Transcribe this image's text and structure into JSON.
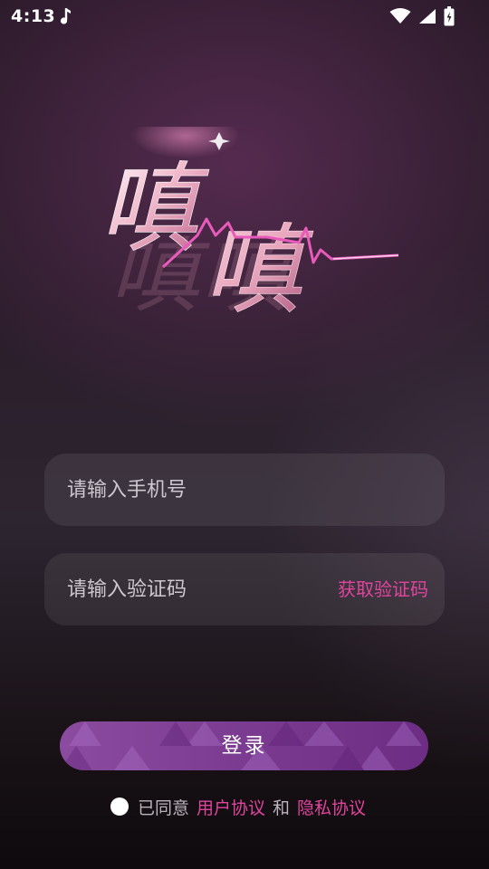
{
  "status_bar": {
    "time": "4:13",
    "icons": [
      "music-note-icon",
      "wifi-icon",
      "signal-icon",
      "battery-icon"
    ]
  },
  "logo": {
    "text": "嗔嗔",
    "accent_color": "#e0459e"
  },
  "form": {
    "phone": {
      "placeholder": "请输入手机号",
      "value": ""
    },
    "code": {
      "placeholder": "请输入验证码",
      "value": ""
    },
    "get_code_label": "获取验证码"
  },
  "login": {
    "label": "登录"
  },
  "agreement": {
    "prefix": "已同意",
    "user_agreement": "用户协议",
    "conjunction": "和",
    "privacy_policy": "隐私协议",
    "checked": false
  },
  "colors": {
    "accent": "#e0459e",
    "button": "#7a3b90",
    "background": "#2b1d2b"
  }
}
